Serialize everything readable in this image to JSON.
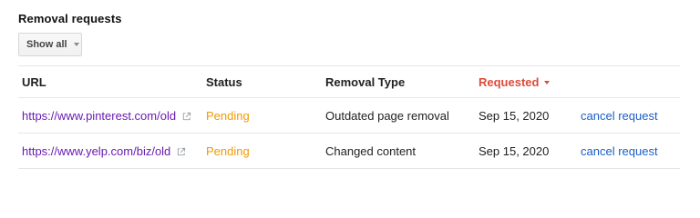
{
  "section": {
    "title": "Removal requests"
  },
  "filter": {
    "label": "Show all"
  },
  "table": {
    "headers": {
      "url": "URL",
      "status": "Status",
      "removal_type": "Removal Type",
      "requested": "Requested"
    },
    "sorted_column": "requested",
    "rows": [
      {
        "url": "https://www.pinterest.com/old",
        "status": "Pending",
        "removal_type": "Outdated page removal",
        "requested": "Sep 15, 2020",
        "action": "cancel request"
      },
      {
        "url": "https://www.yelp.com/biz/old",
        "status": "Pending",
        "removal_type": "Changed content",
        "requested": "Sep 15, 2020",
        "action": "cancel request"
      }
    ]
  },
  "colors": {
    "link_visited": "#6a1ab3",
    "status_pending": "#f29900",
    "sorted_header": "#dd4b39",
    "action_link": "#1a5dc8"
  },
  "icons": {
    "external_link": "external-link-icon",
    "filter_caret": "chevron-down-icon",
    "sort_caret": "sort-descending-icon"
  }
}
